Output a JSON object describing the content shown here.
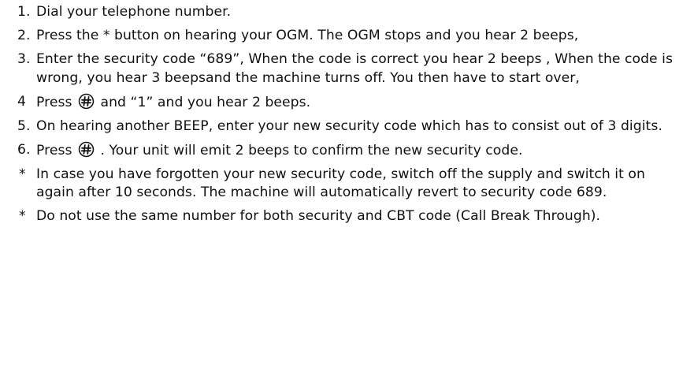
{
  "document": {
    "steps": [
      {
        "marker": "1.",
        "text": "Dial your telephone number."
      },
      {
        "marker": "2.",
        "text": "Press the * button on hearing your OGM. The OGM stops and you hear 2 beeps,"
      },
      {
        "marker": "3.",
        "text": "Enter the security code “689”, When the code is correct you hear 2 beeps , When the code is wrong, you hear 3 beepsand the machine turns off. You then have to start over,"
      },
      {
        "marker": "4",
        "text_before": "Press",
        "text_after": " and “1” and you hear 2 beeps."
      },
      {
        "marker": "5.",
        "text": "On hearing another BEEP, enter your new security code which has to consist out of 3 digits."
      },
      {
        "marker": "6.",
        "text_before": "Press",
        "text_after": ". Your unit will emit 2 beeps to confirm the new security code."
      }
    ],
    "notes": [
      {
        "marker": "*",
        "text": "In case you have forgotten your new security code, switch off the supply and switch it on again after 10 seconds. The machine will automatically revert to security code 689."
      },
      {
        "marker": "*",
        "text": "Do not use the same number for both security and CBT code (Call Break Through)."
      }
    ],
    "icons": {
      "hash_key": "hash-key-icon"
    }
  }
}
